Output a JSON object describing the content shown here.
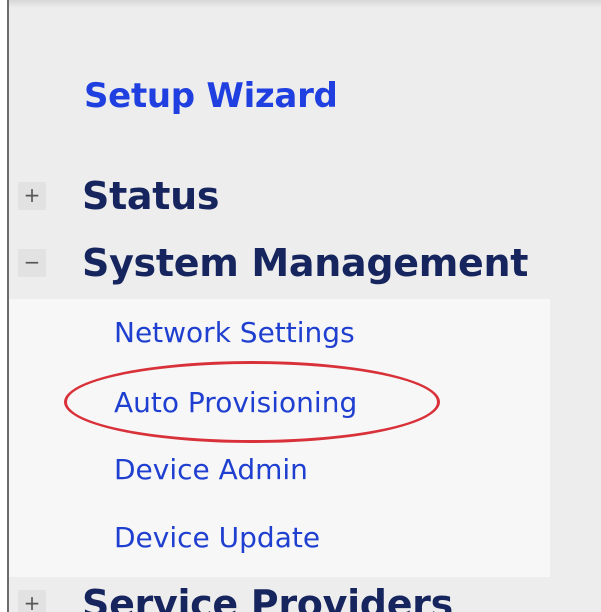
{
  "nav": {
    "setup_wizard": "Setup Wizard",
    "items": [
      {
        "label": "Status",
        "toggle": "+",
        "expanded": false
      },
      {
        "label": "System Management",
        "toggle": "−",
        "expanded": true
      },
      {
        "label": "Service Providers",
        "toggle": "+",
        "expanded": false
      }
    ],
    "submenu": [
      {
        "label": "Network Settings"
      },
      {
        "label": "Auto Provisioning",
        "highlighted": true
      },
      {
        "label": "Device Admin"
      },
      {
        "label": "Device Update"
      }
    ]
  },
  "colors": {
    "link_blue": "#1f3fe0",
    "heading_navy": "#16255e",
    "highlight_red": "#d8313a",
    "panel_bg": "#ededed",
    "submenu_bg": "#f7f7f7"
  }
}
